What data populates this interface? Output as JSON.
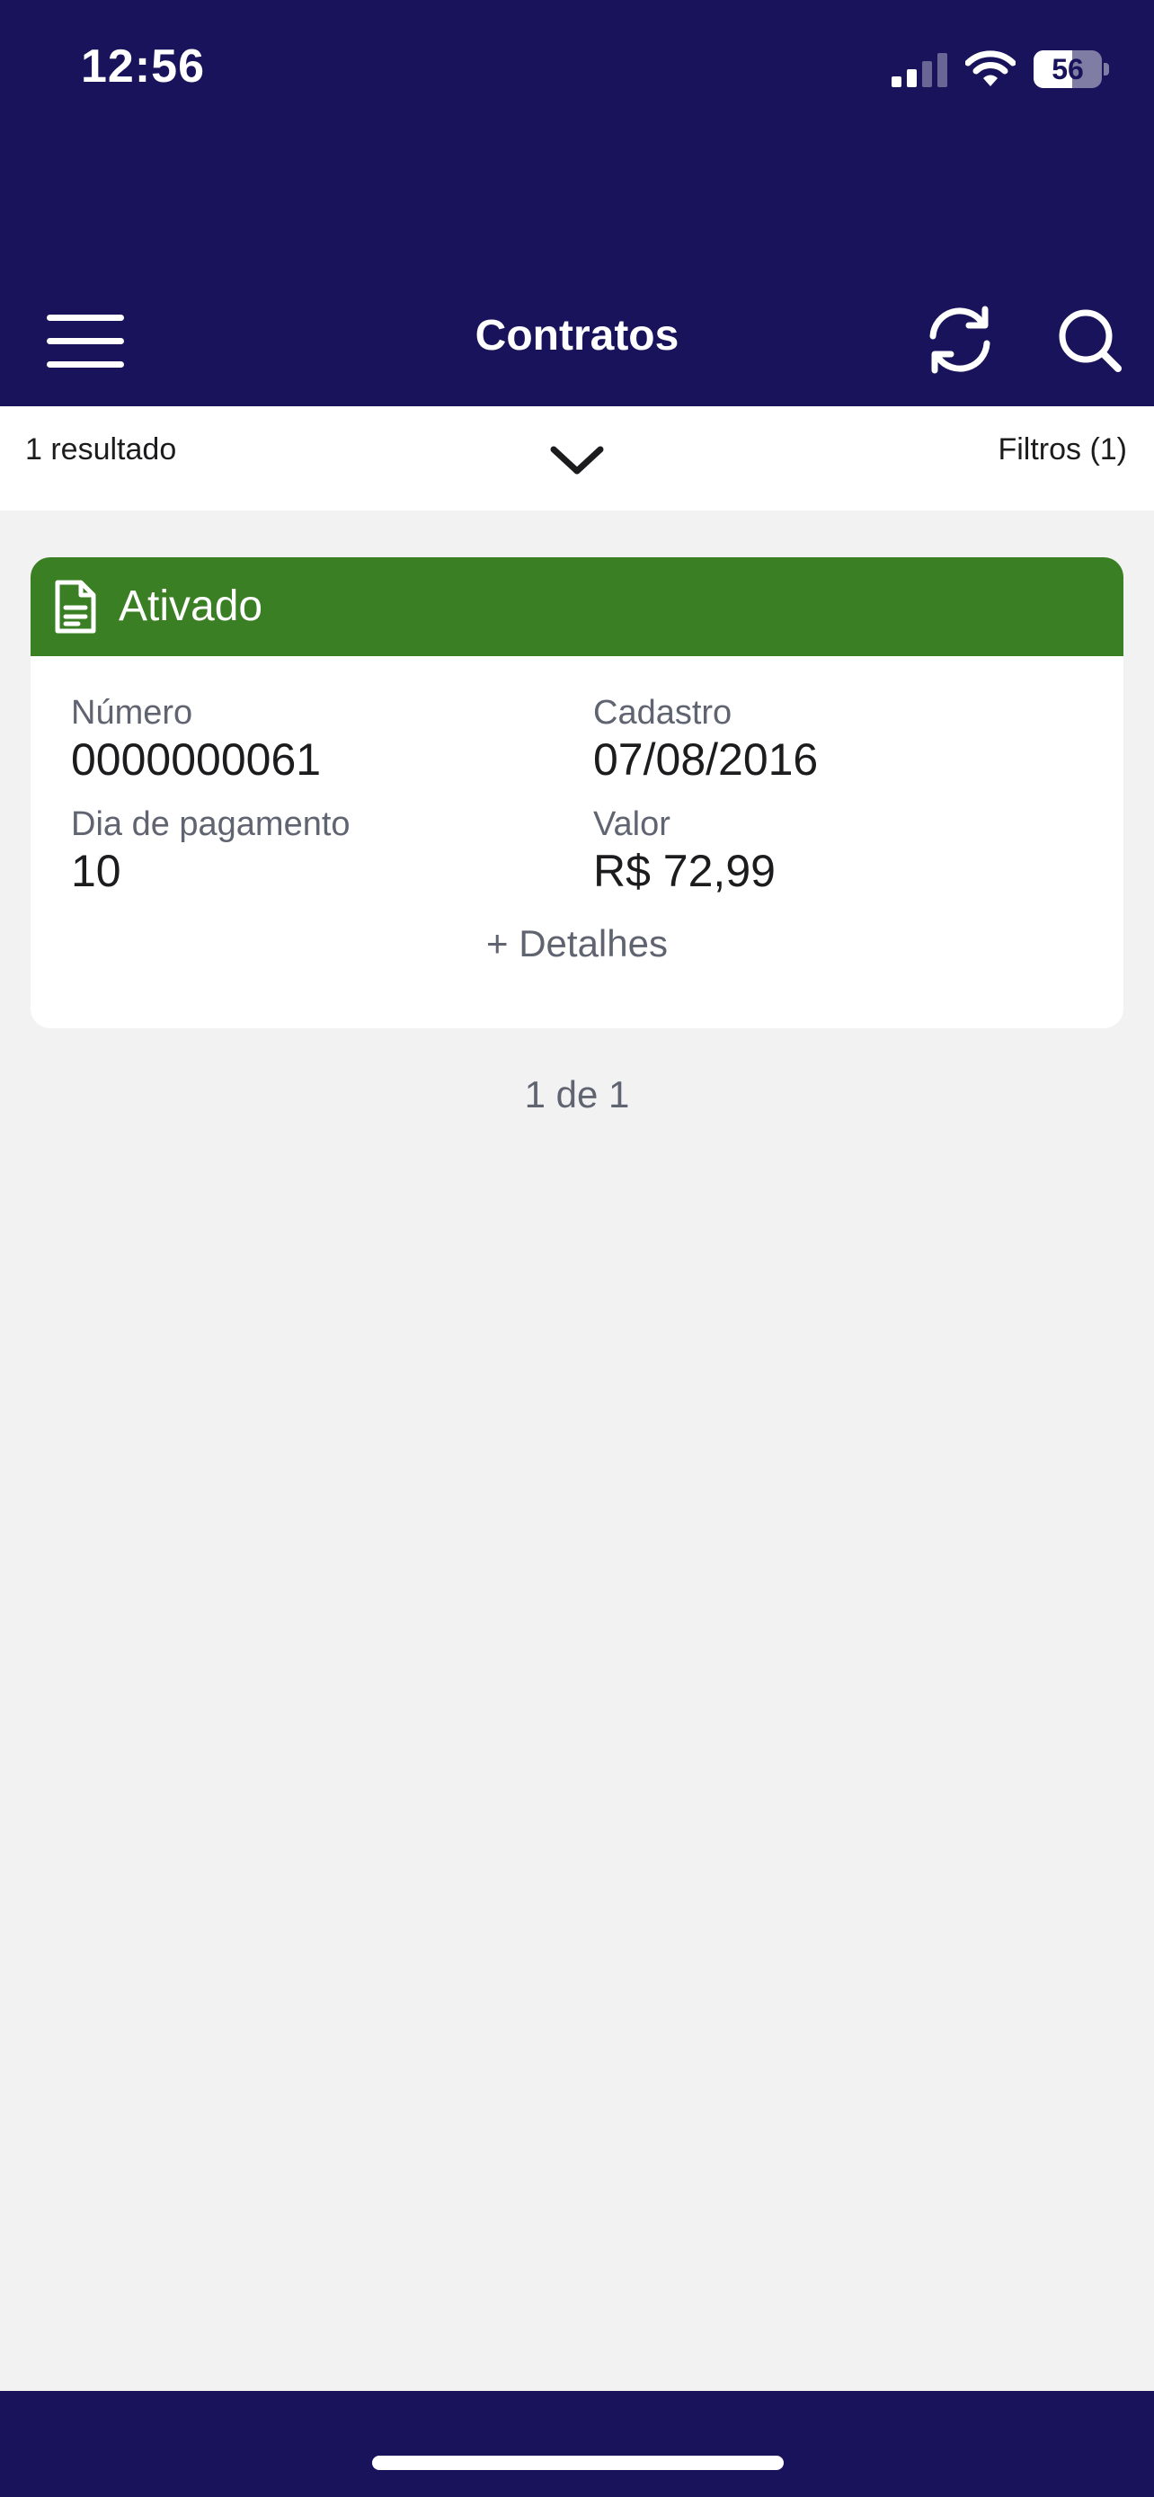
{
  "status_bar": {
    "time": "12:56",
    "battery_level": "56"
  },
  "nav": {
    "title": "Contratos"
  },
  "filter_bar": {
    "result_count": "1 resultado",
    "filters_label": "Filtros (1)"
  },
  "contract": {
    "status": "Ativado",
    "number_label": "Número",
    "number_value": "0000000061",
    "registration_label": "Cadastro",
    "registration_value": "07/08/2016",
    "payment_day_label": "Dia de pagamento",
    "payment_day_value": "10",
    "value_label": "Valor",
    "value_value": "R$ 72,99",
    "details_label": "+ Detalhes"
  },
  "pagination": {
    "text": "1 de 1"
  },
  "colors": {
    "primary": "#19135c",
    "status_active": "#3a7f23",
    "background": "#f2f2f3"
  },
  "icons": {
    "menu": "hamburger-menu-icon",
    "refresh": "refresh-icon",
    "search": "search-icon",
    "expand": "chevron-down-icon",
    "document": "document-icon"
  }
}
